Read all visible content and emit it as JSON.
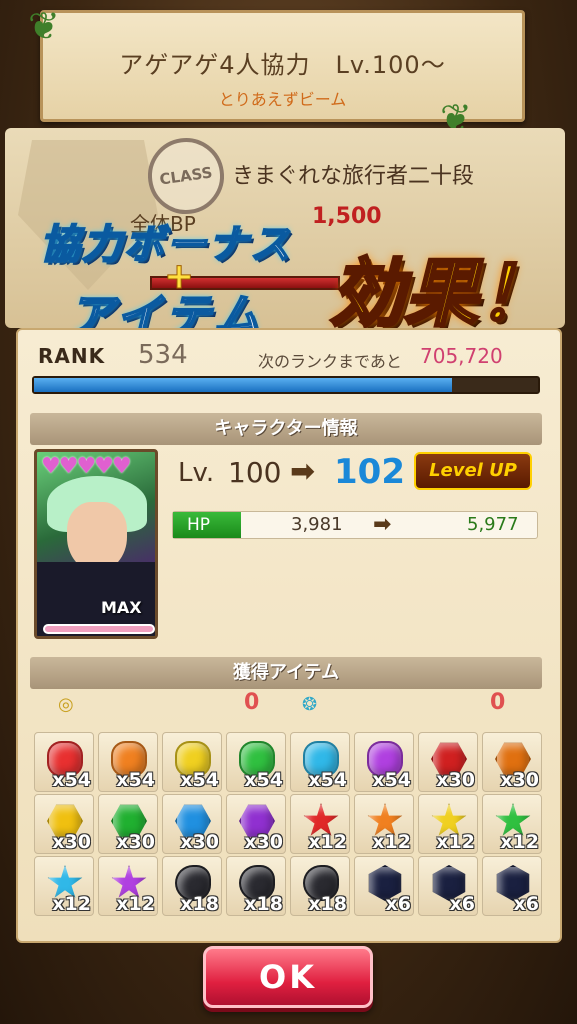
{
  "quest": {
    "title": "アゲアゲ4人協力　Lv.100～",
    "subtitle": "とりあえずビーム"
  },
  "player_class": {
    "stamp": "CLASS",
    "name": "きまぐれな旅行者二十段",
    "bp_label": "全体BP",
    "bp_value": "1,500"
  },
  "overlay": {
    "line1": "協力ボーナス",
    "plus": "+",
    "line2": "アイテム",
    "effect": "効果！"
  },
  "rank": {
    "label": "RANK",
    "value": "534",
    "next_label": "次のランクまであと",
    "next_value": "705,720",
    "progress": 0.83
  },
  "character": {
    "header": "キャラクター情報",
    "hearts": "♥♥♥♥♥",
    "max_label": "MAX",
    "lv_label": "Lv.",
    "lv_from": "100",
    "lv_to": "102",
    "levelup_label": "Level UP",
    "hp_label": "HP",
    "hp_from": "3,981",
    "hp_to": "5,977"
  },
  "items": {
    "header": "獲得アイテム",
    "currency": [
      {
        "icon": "gold-coin-icon",
        "value": "0"
      },
      {
        "icon": "blue-swirl-icon",
        "value": "0"
      }
    ],
    "grid": [
      {
        "shape": "gem",
        "color": "#e83030",
        "qty": "x54"
      },
      {
        "shape": "gem",
        "color": "#f08020",
        "qty": "x54"
      },
      {
        "shape": "gem",
        "color": "#f0d020",
        "qty": "x54"
      },
      {
        "shape": "gem",
        "color": "#30c040",
        "qty": "x54"
      },
      {
        "shape": "gem",
        "color": "#30b8e8",
        "qty": "x54"
      },
      {
        "shape": "gem",
        "color": "#b040e0",
        "qty": "x54"
      },
      {
        "shape": "hex",
        "color": "#d02020",
        "qty": "x30"
      },
      {
        "shape": "hex",
        "color": "#e07010",
        "qty": "x30"
      },
      {
        "shape": "hex",
        "color": "#f0c010",
        "qty": "x30"
      },
      {
        "shape": "hex",
        "color": "#20b030",
        "qty": "x30"
      },
      {
        "shape": "hex",
        "color": "#2090e0",
        "qty": "x30"
      },
      {
        "shape": "hex",
        "color": "#9030d0",
        "qty": "x30"
      },
      {
        "shape": "star",
        "color": "#e02828",
        "qty": "x12"
      },
      {
        "shape": "star",
        "color": "#f08020",
        "qty": "x12"
      },
      {
        "shape": "star",
        "color": "#f0d020",
        "qty": "x12"
      },
      {
        "shape": "star",
        "color": "#30c040",
        "qty": "x12"
      },
      {
        "shape": "star",
        "color": "#30b8e8",
        "qty": "x12"
      },
      {
        "shape": "star",
        "color": "#b040e0",
        "qty": "x12"
      },
      {
        "shape": "stone",
        "color": "#2a2a30",
        "qty": "x18"
      },
      {
        "shape": "stone",
        "color": "#2a2a30",
        "qty": "x18"
      },
      {
        "shape": "stone",
        "color": "#2a2a30",
        "qty": "x18"
      },
      {
        "shape": "crystal",
        "color": "#1a2040",
        "qty": "x6"
      },
      {
        "shape": "crystal",
        "color": "#1a2040",
        "qty": "x6"
      },
      {
        "shape": "crystal",
        "color": "#1a2040",
        "qty": "x6"
      }
    ]
  },
  "ok_button": "OK"
}
